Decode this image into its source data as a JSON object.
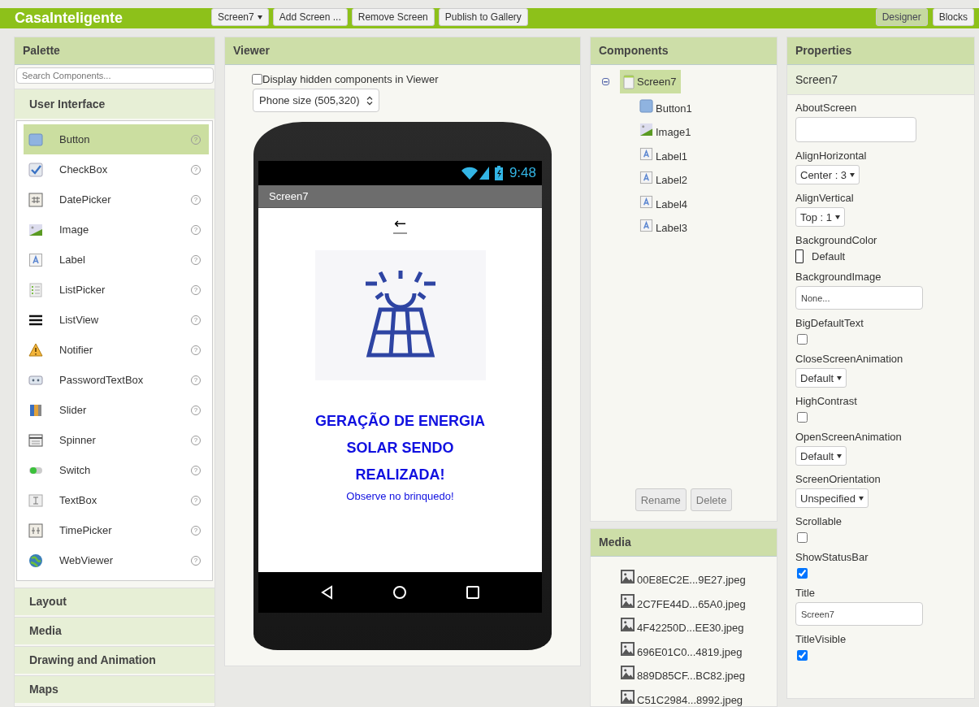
{
  "app_bar": {
    "title": "CasaInteligente",
    "screen_select": "Screen7",
    "buttons": [
      "Add Screen ...",
      "Remove Screen",
      "Publish to Gallery"
    ],
    "modes": [
      {
        "label": "Designer",
        "selected": true
      },
      {
        "label": "Blocks",
        "selected": false
      }
    ]
  },
  "palette": {
    "title": "Palette",
    "search": {
      "placeholder": "Search Components..."
    },
    "categories": [
      {
        "label": "User Interface",
        "expanded": true,
        "items": [
          {
            "label": "Button",
            "kind": "button",
            "selected": true,
            "help": "?"
          },
          {
            "label": "CheckBox",
            "kind": "checkbox",
            "selected": false,
            "help": "?"
          },
          {
            "label": "DatePicker",
            "kind": "datepicker",
            "selected": false,
            "help": "?"
          },
          {
            "label": "Image",
            "kind": "image",
            "selected": false,
            "help": "?"
          },
          {
            "label": "Label",
            "kind": "label",
            "selected": false,
            "help": "?"
          },
          {
            "label": "ListPicker",
            "kind": "listpicker",
            "selected": false,
            "help": "?"
          },
          {
            "label": "ListView",
            "kind": "listview",
            "selected": false,
            "help": "?"
          },
          {
            "label": "Notifier",
            "kind": "notifier",
            "selected": false,
            "help": "?"
          },
          {
            "label": "PasswordTextBox",
            "kind": "password",
            "selected": false,
            "help": "?"
          },
          {
            "label": "Slider",
            "kind": "slider",
            "selected": false,
            "help": "?"
          },
          {
            "label": "Spinner",
            "kind": "spinner",
            "selected": false,
            "help": "?"
          },
          {
            "label": "Switch",
            "kind": "switch",
            "selected": false,
            "help": "?"
          },
          {
            "label": "TextBox",
            "kind": "textbox",
            "selected": false,
            "help": "?"
          },
          {
            "label": "TimePicker",
            "kind": "timepicker",
            "selected": false,
            "help": "?"
          },
          {
            "label": "WebViewer",
            "kind": "webviewer",
            "selected": false,
            "help": "?"
          }
        ]
      },
      {
        "label": "Layout",
        "expanded": false
      },
      {
        "label": "Media",
        "expanded": false
      },
      {
        "label": "Drawing and Animation",
        "expanded": false
      },
      {
        "label": "Maps",
        "expanded": false
      }
    ]
  },
  "viewer": {
    "title": "Viewer",
    "hidden_toggle": {
      "label": "Display hidden components in Viewer",
      "checked": false
    },
    "size_select": "Phone size (505,320)",
    "phone": {
      "time": "9:48",
      "screen_title": "Screen7",
      "back_button": "←",
      "labels": [
        {
          "text": "GERAÇÃO DE ENERGIA",
          "bold": true
        },
        {
          "text": "SOLAR SENDO",
          "bold": true
        },
        {
          "text": "REALIZADA!",
          "bold": true
        },
        {
          "text": "Observe no brinquedo!",
          "bold": false
        }
      ]
    }
  },
  "components": {
    "title": "Components",
    "tree": [
      {
        "label": "Screen7",
        "kind": "screen",
        "selected": true,
        "expanded": true,
        "children": [
          {
            "label": "Button1",
            "kind": "button",
            "selected": false
          },
          {
            "label": "Image1",
            "kind": "image",
            "selected": false
          },
          {
            "label": "Label1",
            "kind": "label",
            "selected": false
          },
          {
            "label": "Label2",
            "kind": "label",
            "selected": false
          },
          {
            "label": "Label4",
            "kind": "label",
            "selected": false
          },
          {
            "label": "Label3",
            "kind": "label",
            "selected": false
          }
        ]
      }
    ],
    "buttons": [
      "Rename",
      "Delete"
    ]
  },
  "media": {
    "title": "Media",
    "files": [
      "00E8EC2E...9E27.jpeg",
      "2C7FE44D...65A0.jpeg",
      "4F42250D...EE30.jpeg",
      "696E01C0...4819.jpeg",
      "889D85CF...BC82.jpeg",
      "C51C2984...8992.jpeg"
    ]
  },
  "properties": {
    "title": "Properties",
    "component": "Screen7",
    "items": [
      {
        "name": "AboutScreen",
        "kind": "textarea"
      },
      {
        "name": "AlignHorizontal",
        "kind": "select",
        "value": "Center : 3"
      },
      {
        "name": "AlignVertical",
        "kind": "select",
        "value": "Top : 1"
      },
      {
        "name": "BackgroundColor",
        "kind": "color",
        "value": "Default",
        "color": "#ffffff"
      },
      {
        "name": "BackgroundImage",
        "kind": "text",
        "value": "None..."
      },
      {
        "name": "BigDefaultText",
        "kind": "checkbox",
        "checked": false
      },
      {
        "name": "CloseScreenAnimation",
        "kind": "select",
        "value": "Default"
      },
      {
        "name": "HighContrast",
        "kind": "checkbox",
        "checked": false
      },
      {
        "name": "OpenScreenAnimation",
        "kind": "select",
        "value": "Default"
      },
      {
        "name": "ScreenOrientation",
        "kind": "select",
        "value": "Unspecified"
      },
      {
        "name": "Scrollable",
        "kind": "checkbox",
        "checked": false
      },
      {
        "name": "ShowStatusBar",
        "kind": "checkbox",
        "checked": true
      },
      {
        "name": "Title",
        "kind": "text",
        "value": "Screen7"
      },
      {
        "name": "TitleVisible",
        "kind": "checkbox",
        "checked": true
      }
    ]
  }
}
